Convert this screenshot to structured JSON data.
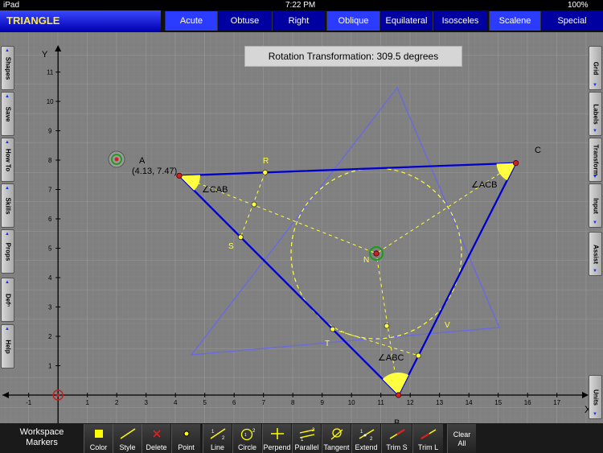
{
  "status": {
    "carrier": "iPad",
    "time": "7:22 PM",
    "battery": "100%"
  },
  "app_title": "TRIANGLE",
  "tabs": [
    "Acute",
    "Obtuse",
    "Right",
    "Oblique",
    "Equilateral",
    "Isosceles",
    "Scalene",
    "Special"
  ],
  "active_tabs": [
    "Acute",
    "Oblique",
    "Scalene"
  ],
  "left_tabs": [
    "Shapes",
    "Save",
    "How To",
    "Skills",
    "Props",
    "Defⁿ",
    "Help"
  ],
  "right_tabs": [
    "Grid",
    "Labels",
    "Transform",
    "Input",
    "Assist",
    "Units"
  ],
  "banner": "Rotation Transformation:  309.5 degrees",
  "axes": {
    "x_label": "X",
    "y_label": "Y",
    "x_ticks": [
      "-1",
      "1",
      "2",
      "3",
      "4",
      "5",
      "6",
      "7",
      "8",
      "9",
      "10",
      "11",
      "12",
      "13",
      "14",
      "15",
      "16",
      "17"
    ],
    "y_ticks": [
      "1",
      "2",
      "3",
      "4",
      "5",
      "6",
      "7",
      "8",
      "9",
      "10",
      "11"
    ]
  },
  "points": {
    "A": {
      "label": "A",
      "coord_label": "(4.13, 7.47)",
      "x": 4.13,
      "y": 7.47
    },
    "B": {
      "label": "B",
      "x": 11.6,
      "y": 0.0
    },
    "C": {
      "label": "C",
      "x": 15.6,
      "y": 7.9
    },
    "R": {
      "label": "R"
    },
    "S": {
      "label": "S"
    },
    "T": {
      "label": "T"
    },
    "V": {
      "label": "V"
    },
    "N": {
      "label": "N"
    }
  },
  "angle_labels": {
    "CAB": "∠CAB",
    "ACB": "∠ACB",
    "ABC": "∠ABC"
  },
  "bottom": {
    "workspace_line1": "Workspace",
    "workspace_line2": "Markers",
    "tools": [
      "Color",
      "Style",
      "Delete",
      "Point",
      "Line",
      "Circle",
      "Perpend",
      "Parallel",
      "Tangent",
      "Extend",
      "Trim S",
      "Trim L"
    ],
    "clear_line1": "Clear",
    "clear_line2": "All"
  },
  "colors": {
    "triangle": "#0000cc",
    "construction": "#ffff40",
    "rotated": "#6a6ae0",
    "tab_active": "#2b3cff",
    "tab_inactive": "#0000a0"
  }
}
